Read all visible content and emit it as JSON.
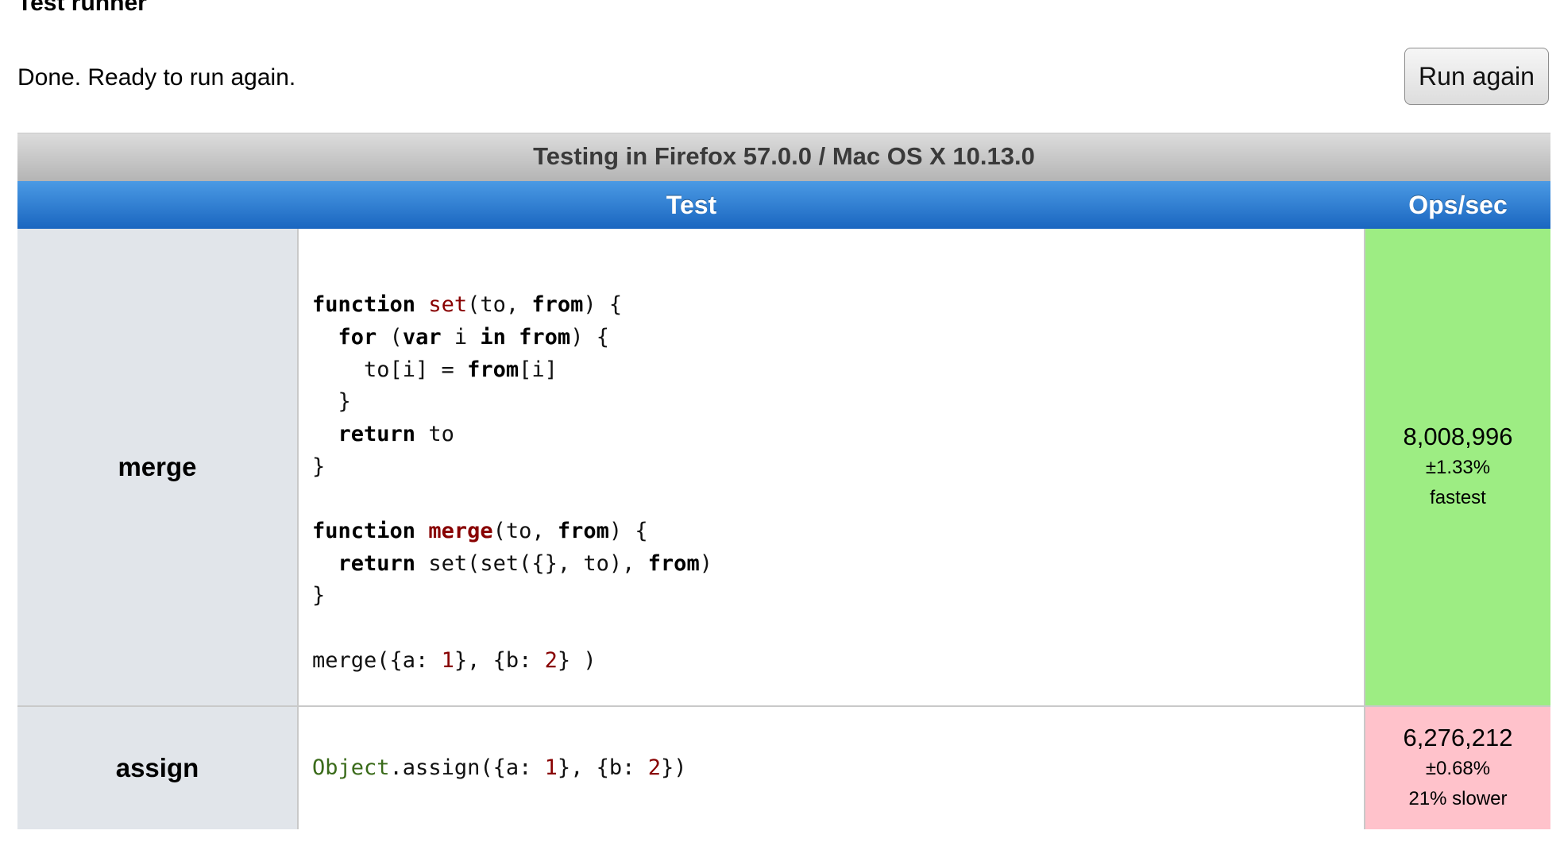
{
  "header": {
    "title": "Test runner",
    "status": "Done. Ready to run again.",
    "run_again_label": "Run again"
  },
  "table": {
    "caption": "Testing in Firefox 57.0.0 / Mac OS X 10.13.0",
    "columns": {
      "test": "Test",
      "ops": "Ops/sec"
    },
    "rows": [
      {
        "name": "merge",
        "code": [
          "",
          "function set(to, from) {",
          "  for (var i in from) {",
          "    to[i] = from[i]",
          "  }",
          "  return to",
          "}",
          "",
          "function merge(to, from) {",
          "  return set(set({}, to), from)",
          "}",
          "",
          "merge({a: 1}, {b: 2} )"
        ],
        "ops": "8,008,996",
        "rme": "±1.33%",
        "note": "fastest"
      },
      {
        "name": "assign",
        "code": [
          "Object.assign({a: 1}, {b: 2})"
        ],
        "ops": "6,276,212",
        "rme": "±0.68%",
        "note": "21% slower"
      }
    ]
  },
  "colors": {
    "fastest": "#9ded83",
    "slower": "#ffc2cb",
    "header_blue": "#1a66c0",
    "name_cell": "#e1e5ea"
  }
}
